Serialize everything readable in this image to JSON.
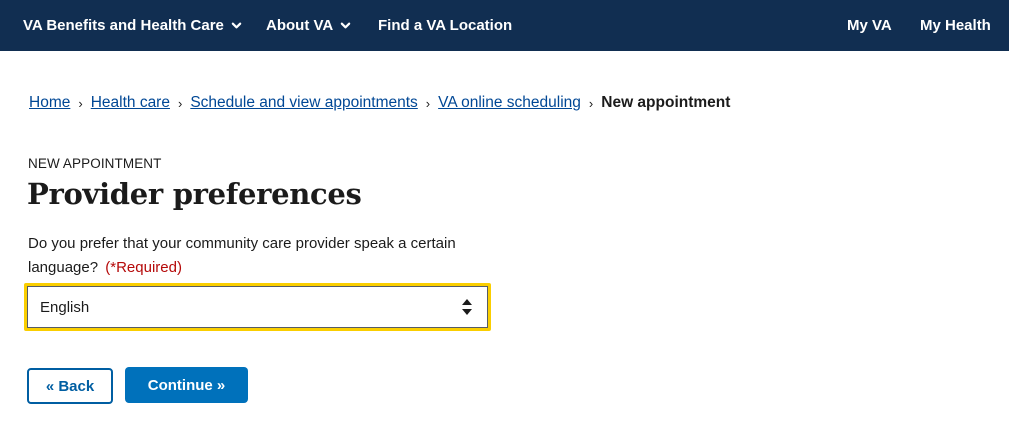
{
  "nav": {
    "benefits": "VA Benefits and Health Care",
    "about": "About VA",
    "find": "Find a VA Location",
    "myva": "My VA",
    "myhealth": "My Health"
  },
  "breadcrumb": {
    "items": [
      "Home",
      "Health care",
      "Schedule and view appointments",
      "VA online scheduling"
    ],
    "current": "New appointment",
    "separator": "›"
  },
  "page": {
    "eyebrow": "NEW APPOINTMENT",
    "title": "Provider preferences",
    "question": "Do you prefer that your community care provider speak a certain language?",
    "required": "(*Required)"
  },
  "language_select": {
    "value": "English"
  },
  "buttons": {
    "back": "« Back",
    "continue": "Continue »"
  },
  "colors": {
    "header_bg": "#112e51",
    "link": "#004795",
    "primary": "#0071bb",
    "focus": "#face00",
    "required": "#b50909"
  },
  "icons": {
    "nav_dropdown": "chevron-down-icon",
    "select": "sort-arrows-icon"
  }
}
